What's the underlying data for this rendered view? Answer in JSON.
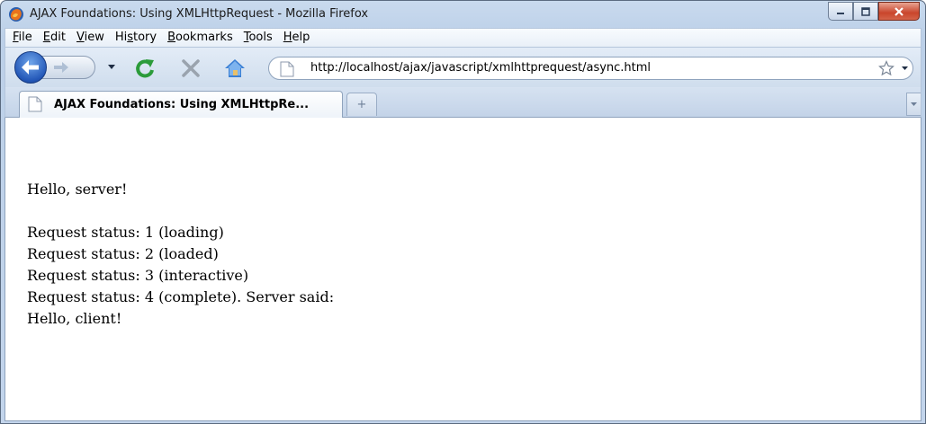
{
  "window": {
    "title": "AJAX Foundations: Using XMLHttpRequest - Mozilla Firefox",
    "icon": "firefox-icon"
  },
  "menu": {
    "items": [
      {
        "label": "File",
        "accel": "F"
      },
      {
        "label": "Edit",
        "accel": "E"
      },
      {
        "label": "View",
        "accel": "V"
      },
      {
        "label": "History",
        "accel": "s"
      },
      {
        "label": "Bookmarks",
        "accel": "B"
      },
      {
        "label": "Tools",
        "accel": "T"
      },
      {
        "label": "Help",
        "accel": "H"
      }
    ]
  },
  "navigation": {
    "url": "http://localhost/ajax/javascript/xmlhttprequest/async.html",
    "icons": [
      "back-icon",
      "forward-icon",
      "history-dropdown-icon",
      "reload-icon",
      "stop-icon",
      "home-icon",
      "page-icon",
      "bookmark-star-icon",
      "url-dropdown-icon"
    ]
  },
  "tabs": {
    "items": [
      {
        "label": "AJAX Foundations: Using XMLHttpRe...",
        "active": true
      }
    ],
    "new_tab_symbol": "+"
  },
  "content": {
    "greeting": "Hello, server!",
    "status_lines": [
      "Request status: 1 (loading)",
      "Request status: 2 (loaded)",
      "Request status: 3 (interactive)",
      "Request status: 4 (complete). Server said:",
      "Hello, client!"
    ]
  },
  "colors": {
    "chrome_blue": "#c3d5ec",
    "back_button": "#2458b8",
    "reload_green": "#2b9b3a",
    "close_red": "#c9452c"
  }
}
